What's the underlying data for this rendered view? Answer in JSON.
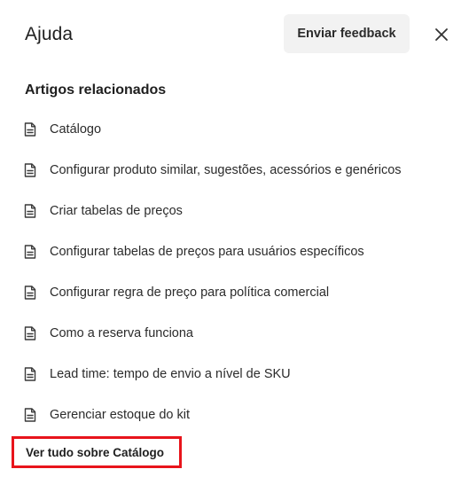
{
  "header": {
    "title": "Ajuda",
    "feedback_label": "Enviar feedback"
  },
  "section": {
    "title": "Artigos relacionados"
  },
  "articles": [
    {
      "label": "Catálogo",
      "icon": "document-icon"
    },
    {
      "label": "Configurar produto similar, sugestões, acessórios e genéricos",
      "icon": "document-icon"
    },
    {
      "label": "Criar tabelas de preços",
      "icon": "document-icon"
    },
    {
      "label": "Configurar tabelas de preços para usuários específicos",
      "icon": "document-icon"
    },
    {
      "label": "Configurar regra de preço para política comercial",
      "icon": "document-icon"
    },
    {
      "label": "Como a reserva funciona",
      "icon": "document-icon"
    },
    {
      "label": "Lead time: tempo de envio a nível de SKU",
      "icon": "document-icon"
    },
    {
      "label": "Gerenciar estoque do kit",
      "icon": "document-icon"
    }
  ],
  "footer": {
    "see_all_label": "Ver tudo sobre Catálogo"
  },
  "colors": {
    "highlight_border": "#e8141b",
    "button_bg": "#f2f2f2",
    "text": "#1f1f1f"
  }
}
